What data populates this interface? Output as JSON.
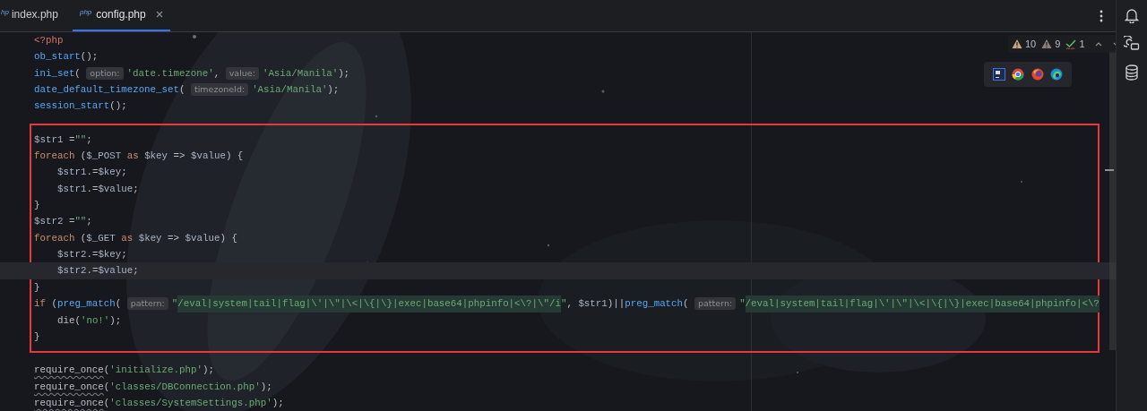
{
  "tabs": [
    {
      "badge": "hp",
      "label": "index.php",
      "selected": false,
      "closable": false
    },
    {
      "badge": "php",
      "label": "config.php",
      "selected": true,
      "closable": true
    }
  ],
  "inspections": [
    {
      "kind": "warning",
      "count": "10"
    },
    {
      "kind": "weak_warning",
      "count": "9"
    },
    {
      "kind": "typo",
      "count": "1"
    }
  ],
  "code_sections": [
    {
      "boxed": false,
      "lines": [
        {
          "current": false,
          "segments": [
            {
              "kind": "tag",
              "text": "<?php"
            }
          ]
        },
        {
          "current": false,
          "segments": [
            {
              "kind": "func",
              "text": "ob_start"
            },
            {
              "kind": "plain",
              "text": "();"
            }
          ]
        },
        {
          "current": false,
          "segments": [
            {
              "kind": "func",
              "text": "ini_set"
            },
            {
              "kind": "plain",
              "text": "( "
            },
            {
              "kind": "hint",
              "text": "option:"
            },
            {
              "kind": "string",
              "text": "'date.timezone'"
            },
            {
              "kind": "plain",
              "text": ", "
            },
            {
              "kind": "hint",
              "text": "value:"
            },
            {
              "kind": "string",
              "text": "'Asia/Manila'"
            },
            {
              "kind": "plain",
              "text": ");"
            }
          ]
        },
        {
          "current": false,
          "segments": [
            {
              "kind": "func",
              "text": "date_default_timezone_set"
            },
            {
              "kind": "plain",
              "text": "( "
            },
            {
              "kind": "hint",
              "text": "timezoneId:"
            },
            {
              "kind": "string",
              "text": "'Asia/Manila'"
            },
            {
              "kind": "plain",
              "text": ");"
            }
          ]
        },
        {
          "current": false,
          "segments": [
            {
              "kind": "func",
              "text": "session_start"
            },
            {
              "kind": "plain",
              "text": "();"
            }
          ]
        }
      ]
    },
    {
      "boxed": true,
      "lines": [
        {
          "current": false,
          "segments": [
            {
              "kind": "var",
              "text": "$str1 "
            },
            {
              "kind": "plain",
              "text": "="
            },
            {
              "kind": "string",
              "text": "\"\""
            },
            {
              "kind": "plain",
              "text": ";"
            }
          ]
        },
        {
          "current": false,
          "segments": [
            {
              "kind": "keyword",
              "text": "foreach "
            },
            {
              "kind": "plain",
              "text": "("
            },
            {
              "kind": "var",
              "text": "$_POST "
            },
            {
              "kind": "keyword",
              "text": "as "
            },
            {
              "kind": "var",
              "text": "$key "
            },
            {
              "kind": "plain",
              "text": "=> "
            },
            {
              "kind": "var",
              "text": "$value"
            },
            {
              "kind": "plain",
              "text": ") {"
            }
          ],
          "children": [
            {
              "current": false,
              "segments": [
                {
                  "kind": "var",
                  "text": "$str1"
                },
                {
                  "kind": "plain",
                  "text": ".="
                },
                {
                  "kind": "var",
                  "text": "$key"
                },
                {
                  "kind": "plain",
                  "text": ";"
                }
              ]
            },
            {
              "current": false,
              "segments": [
                {
                  "kind": "var",
                  "text": "$str1"
                },
                {
                  "kind": "plain",
                  "text": ".="
                },
                {
                  "kind": "var",
                  "text": "$value"
                },
                {
                  "kind": "plain",
                  "text": ";"
                }
              ]
            }
          ]
        },
        {
          "current": false,
          "segments": [
            {
              "kind": "plain",
              "text": "}"
            }
          ]
        },
        {
          "current": false,
          "segments": [
            {
              "kind": "var",
              "text": "$str2 "
            },
            {
              "kind": "plain",
              "text": "="
            },
            {
              "kind": "string",
              "text": "\"\""
            },
            {
              "kind": "plain",
              "text": ";"
            }
          ]
        },
        {
          "current": false,
          "segments": [
            {
              "kind": "keyword",
              "text": "foreach "
            },
            {
              "kind": "plain",
              "text": "("
            },
            {
              "kind": "var",
              "text": "$_GET "
            },
            {
              "kind": "keyword",
              "text": "as "
            },
            {
              "kind": "var",
              "text": "$key "
            },
            {
              "kind": "plain",
              "text": "=> "
            },
            {
              "kind": "var",
              "text": "$value"
            },
            {
              "kind": "plain",
              "text": ") {"
            }
          ],
          "children": [
            {
              "current": false,
              "segments": [
                {
                  "kind": "var",
                  "text": "$str2"
                },
                {
                  "kind": "plain",
                  "text": ".="
                },
                {
                  "kind": "var",
                  "text": "$key"
                },
                {
                  "kind": "plain",
                  "text": ";"
                }
              ]
            },
            {
              "current": true,
              "segments": [
                {
                  "kind": "var",
                  "text": "$str2"
                },
                {
                  "kind": "plain",
                  "text": ".="
                },
                {
                  "kind": "var",
                  "text": "$value"
                },
                {
                  "kind": "plain",
                  "text": ";"
                }
              ]
            }
          ]
        },
        {
          "current": false,
          "segments": [
            {
              "kind": "plain",
              "text": "}"
            }
          ]
        },
        {
          "current": false,
          "segments": [
            {
              "kind": "keyword",
              "text": "if "
            },
            {
              "kind": "plain",
              "text": "("
            },
            {
              "kind": "func",
              "text": "preg_match"
            },
            {
              "kind": "plain",
              "text": "( "
            },
            {
              "kind": "hint",
              "text": "pattern:"
            },
            {
              "kind": "string",
              "text": "\""
            },
            {
              "kind": "regex",
              "text": "/eval|system|tail|flag|\\'|\\\"|\\<|\\{|\\}|exec|base64|phpinfo|<\\?|\\\"/i"
            },
            {
              "kind": "string",
              "text": "\""
            },
            {
              "kind": "plain",
              "text": ", "
            },
            {
              "kind": "var",
              "text": "$str1"
            },
            {
              "kind": "plain",
              "text": ")||"
            },
            {
              "kind": "func",
              "text": "preg_match"
            },
            {
              "kind": "plain",
              "text": "( "
            },
            {
              "kind": "hint",
              "text": "pattern:"
            },
            {
              "kind": "string",
              "text": "\""
            },
            {
              "kind": "regex",
              "text": "/eval|system|tail|flag|\\'|\\\"|\\<|\\{|\\}|exec|base64|phpinfo|<\\?"
            }
          ],
          "children": [
            {
              "current": false,
              "segments": [
                {
                  "kind": "plain",
                  "text": "die("
                },
                {
                  "kind": "string",
                  "text": "'no!'"
                },
                {
                  "kind": "plain",
                  "text": ");"
                }
              ]
            }
          ]
        },
        {
          "current": false,
          "segments": [
            {
              "kind": "plain",
              "text": "}"
            }
          ]
        }
      ]
    },
    {
      "boxed": false,
      "lines": [
        {
          "current": false,
          "segments": [
            {
              "kind": "plain",
              "text": "require_once",
              "squiggle": true
            },
            {
              "kind": "plain",
              "text": "("
            },
            {
              "kind": "string",
              "text": "'initialize.php'"
            },
            {
              "kind": "plain",
              "text": ");"
            }
          ]
        },
        {
          "current": false,
          "segments": [
            {
              "kind": "plain",
              "text": "require_once",
              "squiggle": true
            },
            {
              "kind": "plain",
              "text": "("
            },
            {
              "kind": "string",
              "text": "'classes/DBConnection.php'"
            },
            {
              "kind": "plain",
              "text": ");"
            }
          ]
        },
        {
          "current": false,
          "segments": [
            {
              "kind": "plain",
              "text": "require_once",
              "squiggle": true
            },
            {
              "kind": "plain",
              "text": "("
            },
            {
              "kind": "string",
              "text": "'classes/SystemSettings.php'"
            },
            {
              "kind": "plain",
              "text": ");"
            }
          ]
        }
      ]
    }
  ]
}
